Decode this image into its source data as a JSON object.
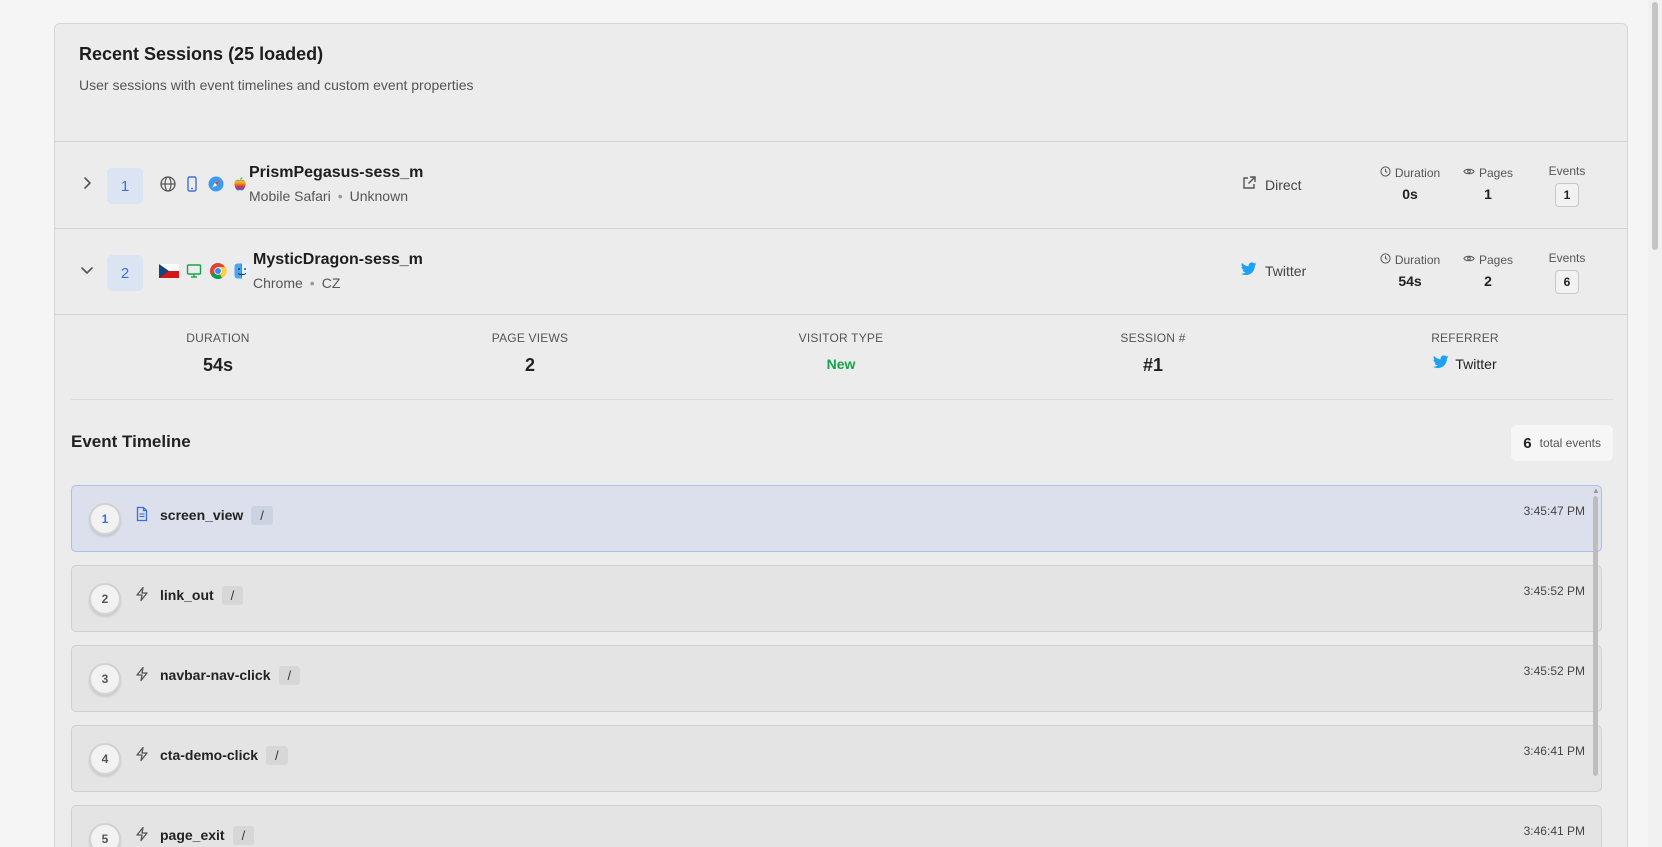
{
  "header": {
    "title": "Recent Sessions (25 loaded)",
    "subtitle": "User sessions with event timelines and custom event properties"
  },
  "sessions": [
    {
      "index": "1",
      "name": "PrismPegasus-sess_m",
      "browser": "Mobile Safari",
      "location": "Unknown",
      "referrer": "Direct",
      "duration_label": "Duration",
      "duration": "0s",
      "pages_label": "Pages",
      "pages": "1",
      "events_label": "Events",
      "events": "1",
      "icons": [
        "globe-icon",
        "mobile-icon",
        "safari-icon",
        "apple-icon"
      ],
      "expanded": false
    },
    {
      "index": "2",
      "name": "MysticDragon-sess_m",
      "browser": "Chrome",
      "location": "CZ",
      "referrer": "Twitter",
      "duration_label": "Duration",
      "duration": "54s",
      "pages_label": "Pages",
      "pages": "2",
      "events_label": "Events",
      "events": "6",
      "icons": [
        "czech-flag-icon",
        "desktop-icon",
        "chrome-icon",
        "macos-finder-icon"
      ],
      "expanded": true
    }
  ],
  "detail": {
    "summary": [
      {
        "label": "DURATION",
        "value": "54s"
      },
      {
        "label": "PAGE VIEWS",
        "value": "2"
      },
      {
        "label": "VISITOR TYPE",
        "value": "New"
      },
      {
        "label": "SESSION #",
        "value": "#1"
      },
      {
        "label": "REFERRER",
        "value": "Twitter"
      }
    ],
    "timeline_title": "Event Timeline",
    "total_count": "6",
    "total_label": "total events",
    "events": [
      {
        "num": "1",
        "name": "screen_view",
        "path": "/",
        "time": "3:45:47 PM",
        "icon": "document-icon"
      },
      {
        "num": "2",
        "name": "link_out",
        "path": "/",
        "time": "3:45:52 PM",
        "icon": "lightning-icon"
      },
      {
        "num": "3",
        "name": "navbar-nav-click",
        "path": "/",
        "time": "3:45:52 PM",
        "icon": "lightning-icon"
      },
      {
        "num": "4",
        "name": "cta-demo-click",
        "path": "/",
        "time": "3:46:41 PM",
        "icon": "lightning-icon"
      },
      {
        "num": "5",
        "name": "page_exit",
        "path": "/",
        "time": "3:46:41 PM",
        "icon": "lightning-icon"
      }
    ]
  },
  "colors": {
    "accent": "#3d6fd8",
    "twitter": "#1da1f2",
    "new_visitor": "#16a34a"
  }
}
